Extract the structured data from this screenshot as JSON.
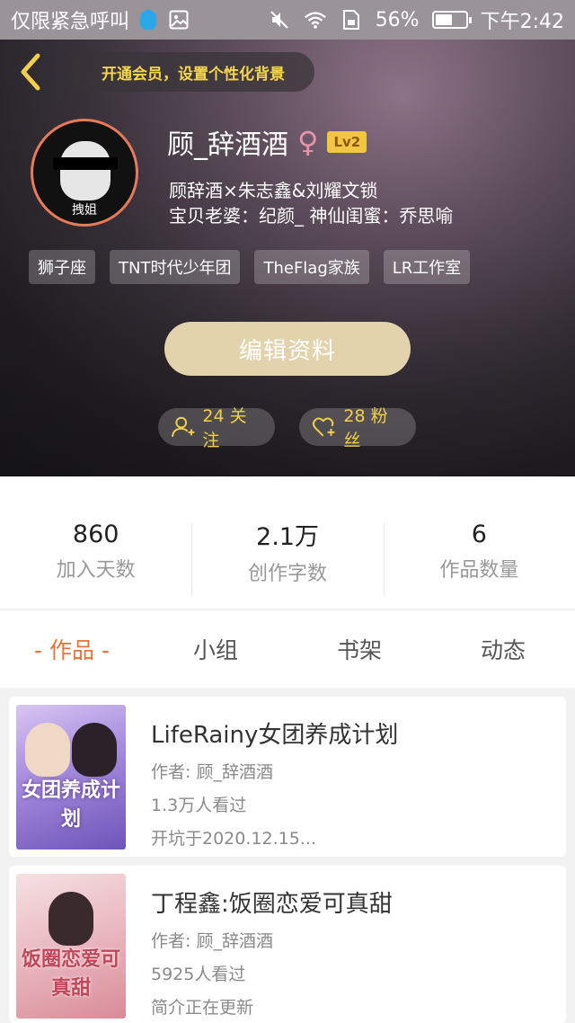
{
  "status_bar": {
    "carrier_text": "仅限紧急呼叫",
    "battery_percent": "56%",
    "time": "下午2:42",
    "battery_level": 0.56
  },
  "header": {
    "vip_banner": "开通会员，设置个性化背景"
  },
  "profile": {
    "username": "顾_辞酒酒",
    "gender_symbol": "♀",
    "level": "Lv2",
    "avatar_caption": "拽姐",
    "bio_line1": "顾辞酒×朱志鑫&刘耀文锁",
    "bio_line2": "宝贝老婆：纪颜_ 神仙闺蜜：乔思喻",
    "tags": [
      "狮子座",
      "TNT时代少年团",
      "TheFlag家族",
      "LR工作室"
    ],
    "edit_button": "编辑资料",
    "following": "24 关注",
    "fans": "28 粉丝"
  },
  "stats": [
    {
      "value": "860",
      "label": "加入天数"
    },
    {
      "value": "2.1万",
      "label": "创作字数"
    },
    {
      "value": "6",
      "label": "作品数量"
    }
  ],
  "tabs": [
    {
      "label": "- 作品 -",
      "active": true
    },
    {
      "label": "小组",
      "active": false
    },
    {
      "label": "书架",
      "active": false
    },
    {
      "label": "动态",
      "active": false
    }
  ],
  "works": [
    {
      "title": "LifeRainy女团养成计划",
      "author": "作者: 顾_辞酒酒",
      "views": "1.3万人看过",
      "extra": "开坑于2020.12.15...",
      "cover_text": "女团养成计划"
    },
    {
      "title": "丁程鑫:饭圈恋爱可真甜",
      "author": "作者: 顾_辞酒酒",
      "views": "5925人看过",
      "extra": "简介正在更新",
      "cover_text": "饭圈恋爱可真甜"
    }
  ],
  "colors": {
    "accent_tab": "#e8733a",
    "vip_text": "#f5d64a",
    "level_badge": "#f2c642",
    "edit_button_bg": "#e2d3ac"
  }
}
